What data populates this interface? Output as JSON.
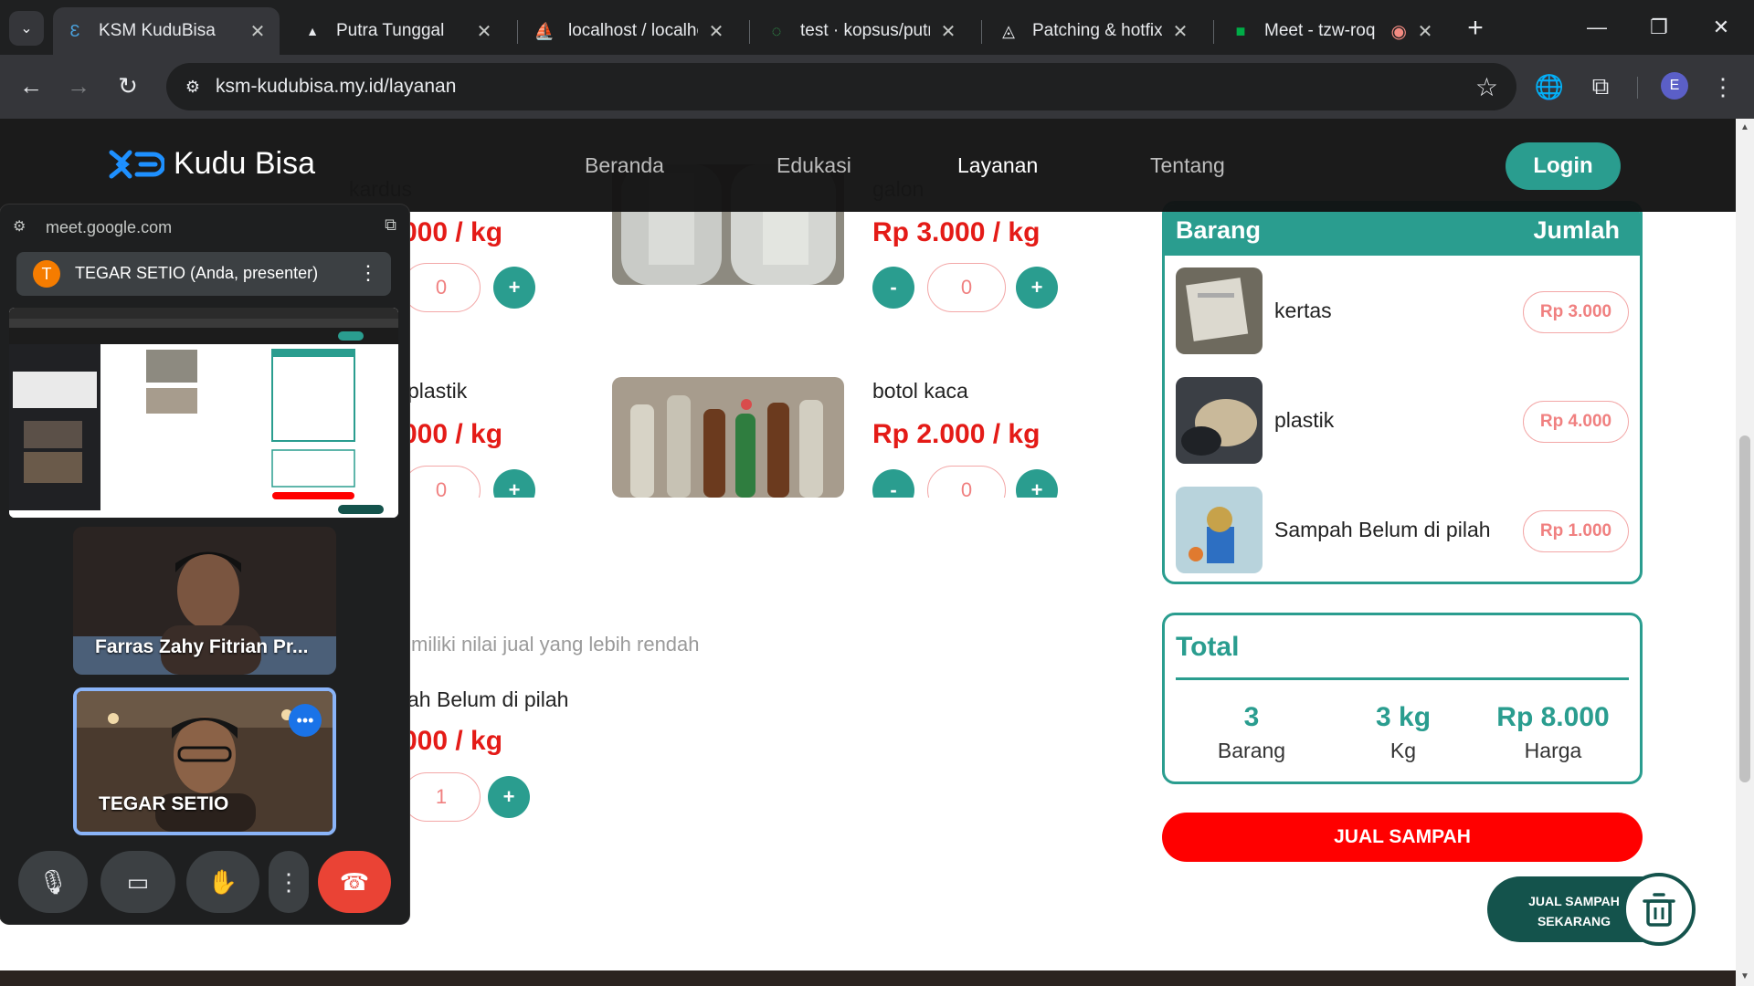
{
  "browser": {
    "tabs": [
      {
        "title": "KSM KuduBisa",
        "active": true
      },
      {
        "title": "Putra Tunggal",
        "active": false
      },
      {
        "title": "localhost / localhost",
        "active": false
      },
      {
        "title": "test · kopsus/putra",
        "active": false
      },
      {
        "title": "Patching & hotfixing",
        "active": false
      },
      {
        "title": "Meet - tzw-roq",
        "active": false
      }
    ],
    "url": "ksm-kudubisa.my.id/layanan",
    "profile_initial": "E"
  },
  "site": {
    "brand": "Kudu Bisa",
    "nav": [
      "Beranda",
      "Edukasi",
      "Layanan",
      "Tentang"
    ],
    "active_nav": "Layanan",
    "login_label": "Login"
  },
  "products": [
    {
      "name": "kardus",
      "price": "000 / kg",
      "qty": "0"
    },
    {
      "name": "galon",
      "price": "Rp 3.000 / kg",
      "qty": "0"
    },
    {
      "name": "plastik",
      "price": "000 / kg",
      "qty": "0"
    },
    {
      "name": "botol kaca",
      "price": "Rp 2.000 / kg",
      "qty": "0"
    },
    {
      "name": "ah Belum di pilah",
      "price": "000 / kg",
      "qty": "1"
    }
  ],
  "note": "miliki nilai jual yang lebih rendah",
  "cart": {
    "col_item": "Barang",
    "col_qty": "Jumlah",
    "items": [
      {
        "name": "kertas",
        "price": "Rp 3.000"
      },
      {
        "name": "plastik",
        "price": "Rp 4.000"
      },
      {
        "name": "Sampah Belum di pilah",
        "price": "Rp 1.000"
      }
    ]
  },
  "total": {
    "title": "Total",
    "count": "3",
    "count_label": "Barang",
    "weight": "3 kg",
    "weight_label": "Kg",
    "price": "Rp 8.000",
    "price_label": "Harga"
  },
  "sell_button": "JUAL SAMPAH",
  "fab_label": "JUAL SAMPAH SEKARANG",
  "meet": {
    "url": "meet.google.com",
    "presenter_initial": "T",
    "presenter": "TEGAR SETIO (Anda, presenter)",
    "participants": [
      "Farras Zahy Fitrian Pr...",
      "TEGAR SETIO"
    ]
  },
  "colors": {
    "teal": "#2a9d8f",
    "red": "#e41b17",
    "dark_teal": "#14534c"
  }
}
